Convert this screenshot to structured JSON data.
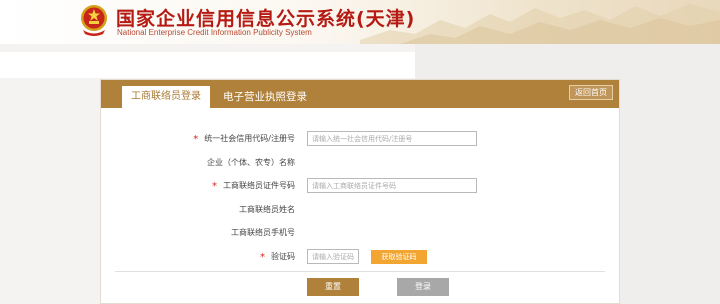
{
  "header": {
    "title": "国家企业信用信息公示系统(天津)",
    "subtitle": "National Enterprise Credit Information Publicity System",
    "emblem_icon": "national-emblem-icon"
  },
  "tabs": [
    {
      "label": "工商联络员登录",
      "active": true
    },
    {
      "label": "电子营业执照登录",
      "active": false
    }
  ],
  "back_button": "返回首页",
  "form": {
    "credit_code": {
      "label": "统一社会信用代码/注册号",
      "required": true,
      "placeholder": "请输入统一社会信用代码/注册号"
    },
    "enterprise_name": {
      "label": "企业（个体、农专）名称",
      "required": false
    },
    "liaison_id": {
      "label": "工商联络员证件号码",
      "required": true,
      "placeholder": "请输入工商联络员证件号码"
    },
    "liaison_name": {
      "label": "工商联络员姓名",
      "required": false
    },
    "liaison_phone": {
      "label": "工商联络员手机号",
      "required": false
    },
    "captcha": {
      "label": "验证码",
      "required": true,
      "placeholder": "请输入验证码"
    },
    "get_code_button": "获取验证码",
    "required_mark": "*"
  },
  "buttons": {
    "reset": "重置",
    "login": "登录"
  },
  "colors": {
    "accent": "#b0813b",
    "title_red": "#b51a13",
    "code_button": "#f2a531",
    "login_disabled": "#a8a8a8"
  }
}
